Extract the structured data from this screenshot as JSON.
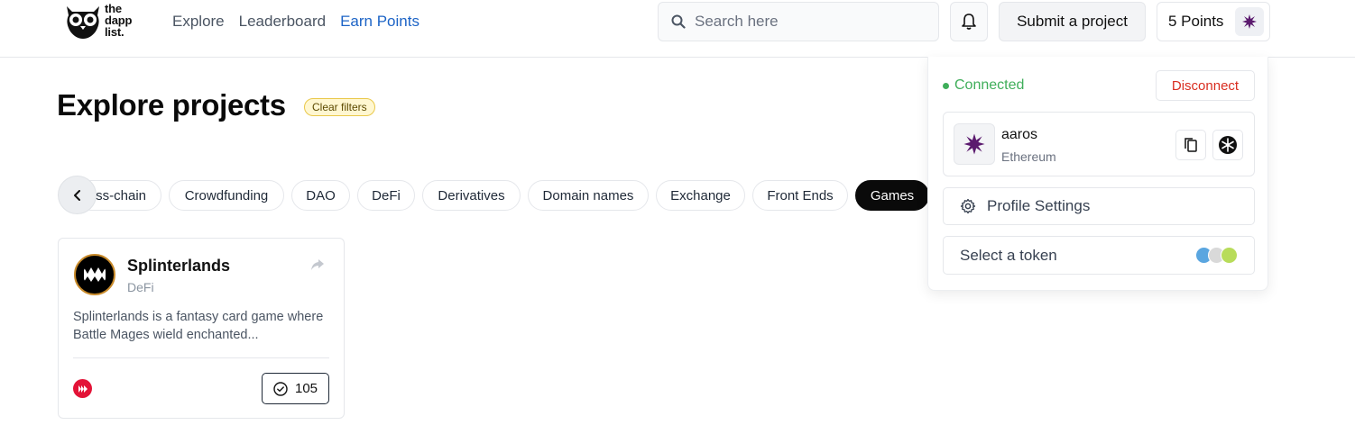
{
  "header": {
    "logo": {
      "line1": "the",
      "line2": "dapp",
      "line3": "list."
    },
    "nav": [
      {
        "label": "Explore",
        "active": false
      },
      {
        "label": "Leaderboard",
        "active": false
      },
      {
        "label": "Earn Points",
        "active": true
      }
    ],
    "search": {
      "placeholder": "Search here",
      "value": ""
    },
    "submit_label": "Submit a project",
    "points_label": "5 Points",
    "icons": {
      "search": "search-icon",
      "notifications": "bell-icon",
      "avatar": "user-avatar"
    }
  },
  "main": {
    "title": "Explore projects",
    "clear_filters_label": "Clear filters",
    "categories": [
      {
        "label": "ss-chain",
        "active": false
      },
      {
        "label": "Crowdfunding",
        "active": false
      },
      {
        "label": "DAO",
        "active": false
      },
      {
        "label": "DeFi",
        "active": false
      },
      {
        "label": "Derivatives",
        "active": false
      },
      {
        "label": "Domain names",
        "active": false
      },
      {
        "label": "Exchange",
        "active": false
      },
      {
        "label": "Front Ends",
        "active": false
      },
      {
        "label": "Games",
        "active": true
      }
    ]
  },
  "projects": [
    {
      "name": "Splinterlands",
      "category": "DeFi",
      "description": "Splinterlands is a fantasy card game where Battle Mages wield enchanted...",
      "votes": "105",
      "chain_color": "#e31337"
    }
  ],
  "wallet_menu": {
    "status": "Connected",
    "disconnect_label": "Disconnect",
    "account": {
      "name": "aaros",
      "network": "Ethereum"
    },
    "profile_settings_label": "Profile Settings",
    "select_token_label": "Select a token"
  },
  "colors": {
    "accent": "#1d64c6",
    "connected": "#3fae5a",
    "danger": "#d92d20",
    "avatar": "#5b1a6e"
  }
}
